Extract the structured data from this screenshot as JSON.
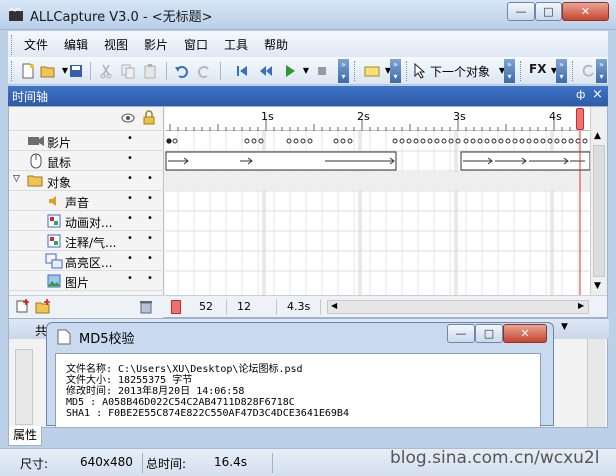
{
  "window": {
    "title": "ALLCapture V3.0 - <无标题>",
    "controls": {
      "minimize": "—",
      "maximize": "□",
      "close": "✕"
    }
  },
  "menubar": {
    "items": [
      "文件",
      "编辑",
      "视图",
      "影片",
      "窗口",
      "工具",
      "帮助"
    ]
  },
  "toolbar": {
    "next_object_label": "下一个对象",
    "fx_label": "FX"
  },
  "timeline": {
    "header_title": "时间轴",
    "pin_glyph": "ф",
    "close_glyph": "×",
    "ruler_ticks": [
      "1s",
      "2s",
      "3s",
      "4s"
    ],
    "tracks": [
      {
        "label": "影片"
      },
      {
        "label": "鼠标"
      },
      {
        "label": "对象"
      },
      {
        "label": "声音"
      },
      {
        "label": "动画对..."
      },
      {
        "label": "注释/气..."
      },
      {
        "label": "高亮区..."
      },
      {
        "label": "图片"
      }
    ],
    "status": {
      "frame": "52",
      "fps": "12 fps",
      "duration": "4.3s"
    }
  },
  "md5_dialog": {
    "title": "MD5校验",
    "lines": [
      "文件名称: C:\\Users\\XU\\Desktop\\论坛图标.psd",
      "文件大小: 18255375 字节",
      "修改时间: 2013年8月20日 14:06:58",
      "MD5      : A058B46D022C54C2AB4711D828F6718C",
      "SHA1     : F0BE2E55C874E822C550AF47D3C4DCE3641E69B4"
    ]
  },
  "lower_panel": {
    "partial_tab": "共",
    "props_tab": "属性"
  },
  "statusbar": {
    "size_label": "尺寸:",
    "size_value": "640x480",
    "total_label": "总时间:",
    "total_value": "16.4s"
  },
  "watermark": "blog.sina.com.cn/wcxu2l",
  "colors": {
    "accent": "#2d5ba8",
    "playhead": "#e03030"
  }
}
